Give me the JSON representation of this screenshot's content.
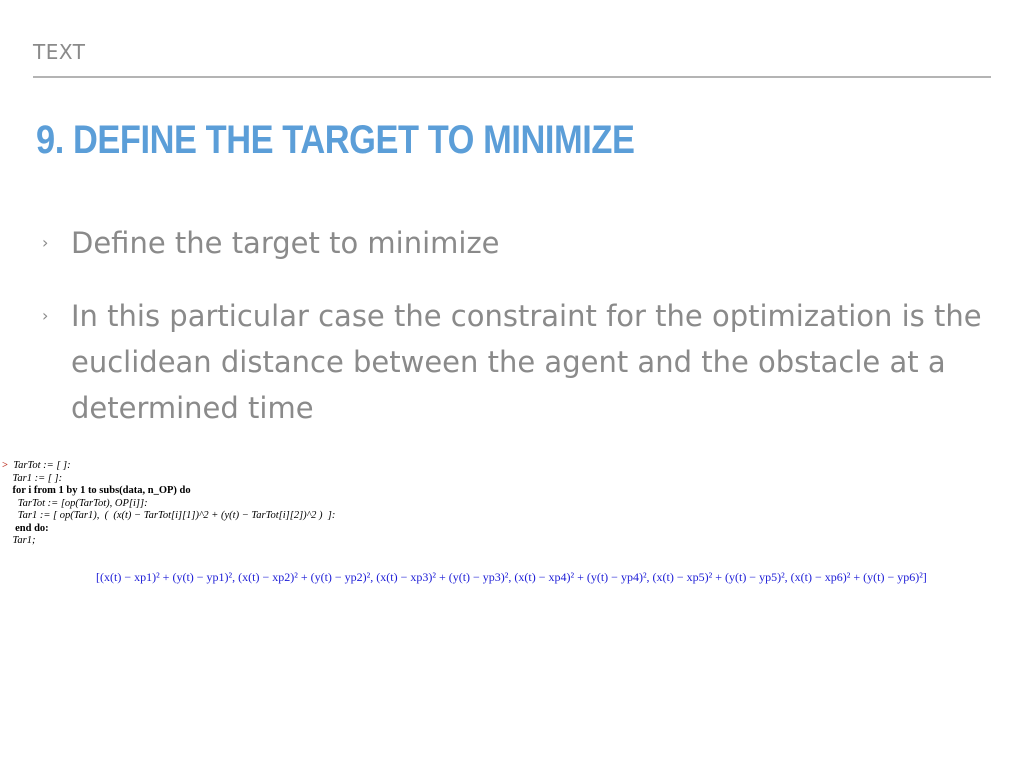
{
  "header": {
    "section_label": "TEXT",
    "title": "9. DEFINE THE TARGET TO MINIMIZE"
  },
  "bullets": [
    {
      "text": "Define the target to minimize"
    },
    {
      "text": "In this particular case the constraint for the optimization is the euclidean distance between the agent and the obstacle at a determined time"
    }
  ],
  "bullet_marker": "›",
  "code": {
    "prompt": ">",
    "lines": [
      "TarTot := [ ]:",
      "Tar1 := [ ]:",
      "for i from 1 by 1 to subs(data, n_OP) do",
      "TarTot := [op(TarTot), OP[i]]:",
      "Tar1 := [ op(Tar1),  (  (x(t) − TarTot[i][1])^2 + (y(t) − TarTot[i][2])^2 )  ]:",
      "end do:",
      "Tar1;"
    ],
    "output": "[(x(t) − xp1)² + (y(t) − yp1)², (x(t) − xp2)² + (y(t) − yp2)², (x(t) − xp3)² + (y(t) − yp3)², (x(t) − xp4)² + (y(t) − yp4)², (x(t) − xp5)² + (y(t) − yp5)², (x(t) − xp6)² + (y(t) − yp6)²]"
  },
  "colors": {
    "title": "#5b9ed8",
    "body_text": "#8a8a8a",
    "divider": "#b4b4b4",
    "prompt": "#c0392b",
    "output": "#1a1ad6"
  }
}
